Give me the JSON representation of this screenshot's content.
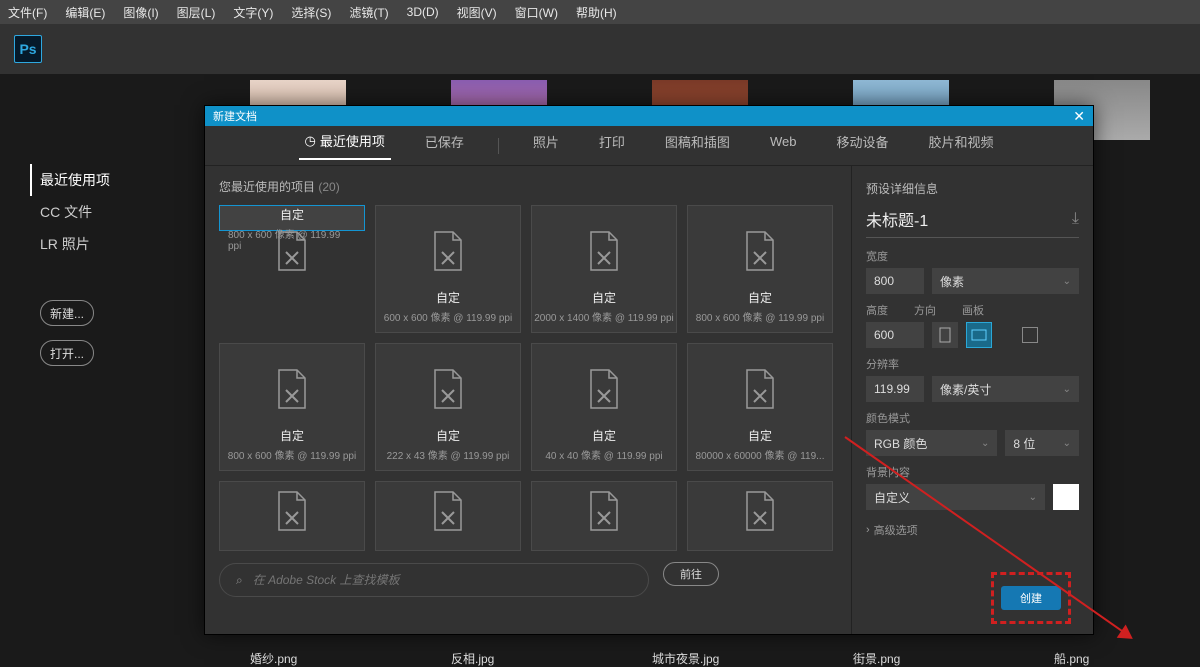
{
  "menu": [
    "文件(F)",
    "编辑(E)",
    "图像(I)",
    "图层(L)",
    "文字(Y)",
    "选择(S)",
    "滤镜(T)",
    "3D(D)",
    "视图(V)",
    "窗口(W)",
    "帮助(H)"
  ],
  "logo": "Ps",
  "sidebar": {
    "items": [
      "最近使用项",
      "CC 文件",
      "LR 照片"
    ],
    "new_btn": "新建...",
    "open_btn": "打开..."
  },
  "thumbs": [
    "婚纱.png",
    "反相.jpg",
    "城市夜景.jpg",
    "街景.png",
    "船.png"
  ],
  "dialog": {
    "title": "新建文档",
    "tabs": [
      "最近使用项",
      "已保存",
      "照片",
      "打印",
      "图稿和插图",
      "Web",
      "移动设备",
      "胶片和视频"
    ],
    "recent_label": "您最近使用的项目",
    "recent_count": "(20)",
    "presets": [
      {
        "name": "自定",
        "dim": "800 x 600 像素 @ 119.99 ppi",
        "sel": true
      },
      {
        "name": "自定",
        "dim": "600 x 600 像素 @ 119.99 ppi"
      },
      {
        "name": "自定",
        "dim": "2000 x 1400 像素 @ 119.99 ppi"
      },
      {
        "name": "自定",
        "dim": "800 x 600 像素 @ 119.99 ppi"
      },
      {
        "name": "自定",
        "dim": "800 x 600 像素 @ 119.99 ppi"
      },
      {
        "name": "自定",
        "dim": "222 x 43 像素 @ 119.99 ppi"
      },
      {
        "name": "自定",
        "dim": "40 x 40 像素 @ 119.99 ppi"
      },
      {
        "name": "自定",
        "dim": "80000 x 60000 像素 @ 119..."
      }
    ],
    "stock_placeholder": "在 Adobe Stock 上查找模板",
    "go_label": "前往"
  },
  "details": {
    "head": "预设详细信息",
    "title": "未标题-1",
    "width_lbl": "宽度",
    "width_val": "800",
    "width_unit": "像素",
    "height_lbl": "高度",
    "height_val": "600",
    "orient_lbl": "方向",
    "artboard_lbl": "画板",
    "res_lbl": "分辨率",
    "res_val": "119.99",
    "res_unit": "像素/英寸",
    "color_lbl": "颜色模式",
    "color_val": "RGB 颜色",
    "bit_val": "8 位",
    "bg_lbl": "背景内容",
    "bg_val": "自定义",
    "adv": "高级选项",
    "create": "创建"
  }
}
